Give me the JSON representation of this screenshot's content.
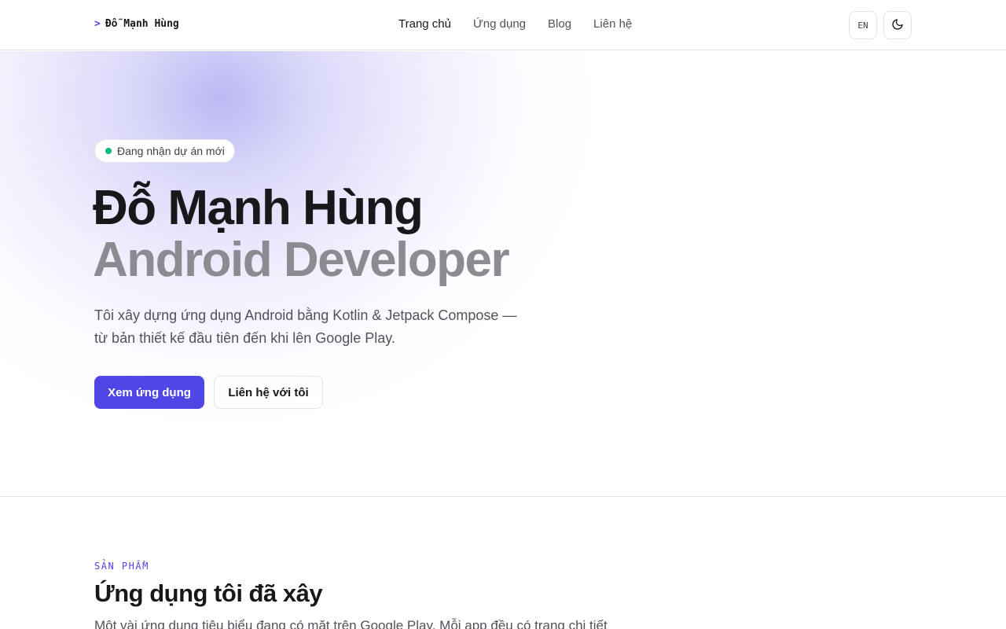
{
  "header": {
    "brand_prompt": ">",
    "brand_name": "Đỗ Mạnh Hùng",
    "nav": [
      {
        "label": "Trang chủ",
        "active": true
      },
      {
        "label": "Ứng dụng",
        "active": false
      },
      {
        "label": "Blog",
        "active": false
      },
      {
        "label": "Liên hệ",
        "active": false
      }
    ],
    "language_label": "EN",
    "theme_icon": "moon-icon"
  },
  "hero": {
    "status_badge": "Đang nhận dự án mới",
    "status_color": "#10b981",
    "name": "Đỗ Mạnh Hùng",
    "role": "Android Developer",
    "description_line1": "Tôi xây dựng ứng dụng Android bằng Kotlin & Jetpack Compose —",
    "description_line2": "từ bản thiết kế đầu tiên đến khi lên Google Play.",
    "primary_button": "Xem ứng dụng",
    "secondary_button": "Liên hệ với tôi"
  },
  "products": {
    "eyebrow": "SẢN PHẨM",
    "title": "Ứng dụng tôi đã xây",
    "description": "Một vài ứng dụng tiêu biểu đang có mặt trên Google Play. Mỗi app đều có trang chi tiết"
  },
  "colors": {
    "accent": "#4f46e5",
    "text": "#18181b",
    "muted": "#52525b",
    "border": "#e4e4e7"
  }
}
